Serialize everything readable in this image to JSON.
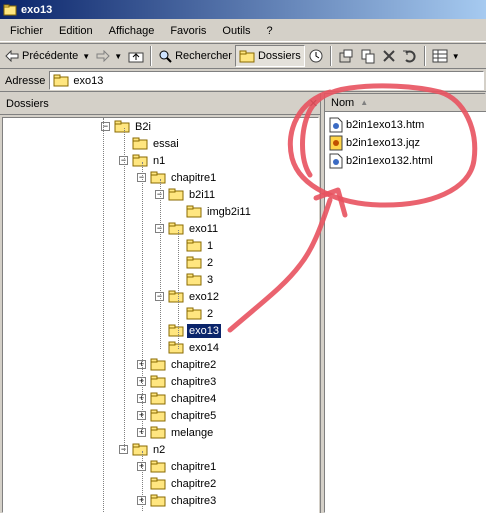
{
  "window": {
    "title": "exo13"
  },
  "menu": [
    "Fichier",
    "Edition",
    "Affichage",
    "Favoris",
    "Outils",
    "?"
  ],
  "toolbar": {
    "back_label": "Précédente",
    "search_label": "Rechercher",
    "folders_label": "Dossiers"
  },
  "address": {
    "label": "Adresse",
    "value": "exo13"
  },
  "left_pane": {
    "title": "Dossiers"
  },
  "tree": [
    {
      "label": "B2i",
      "expander": "minus"
    },
    {
      "label": "essai",
      "expander": "none"
    },
    {
      "label": "n1",
      "expander": "minus"
    },
    {
      "label": "chapitre1",
      "expander": "minus"
    },
    {
      "label": "b2i11",
      "expander": "minus"
    },
    {
      "label": "imgb2i11",
      "expander": "none"
    },
    {
      "label": "exo11",
      "expander": "minus"
    },
    {
      "label": "1",
      "expander": "none"
    },
    {
      "label": "2",
      "expander": "none"
    },
    {
      "label": "3",
      "expander": "none"
    },
    {
      "label": "exo12",
      "expander": "minus"
    },
    {
      "label": "2",
      "expander": "none"
    },
    {
      "label": "exo13",
      "expander": "none",
      "selected": true
    },
    {
      "label": "exo14",
      "expander": "none"
    },
    {
      "label": "chapitre2",
      "expander": "plus"
    },
    {
      "label": "chapitre3",
      "expander": "plus"
    },
    {
      "label": "chapitre4",
      "expander": "plus"
    },
    {
      "label": "chapitre5",
      "expander": "plus"
    },
    {
      "label": "melange",
      "expander": "plus"
    },
    {
      "label": "n2",
      "expander": "minus"
    },
    {
      "label": "chapitre1",
      "expander": "plus"
    },
    {
      "label": "chapitre2",
      "expander": "none"
    },
    {
      "label": "chapitre3",
      "expander": "plus"
    }
  ],
  "right_pane": {
    "column_name": "Nom",
    "files": [
      {
        "name": "b2in1exo13.htm",
        "icon": "html-file-icon"
      },
      {
        "name": "b2in1exo13.jqz",
        "icon": "jqz-file-icon"
      },
      {
        "name": "b2in1exo132.html",
        "icon": "html-file-icon"
      }
    ]
  },
  "colors": {
    "selection": "#0a246a",
    "annotation": "#e8525f",
    "folder": "#ffe680"
  }
}
